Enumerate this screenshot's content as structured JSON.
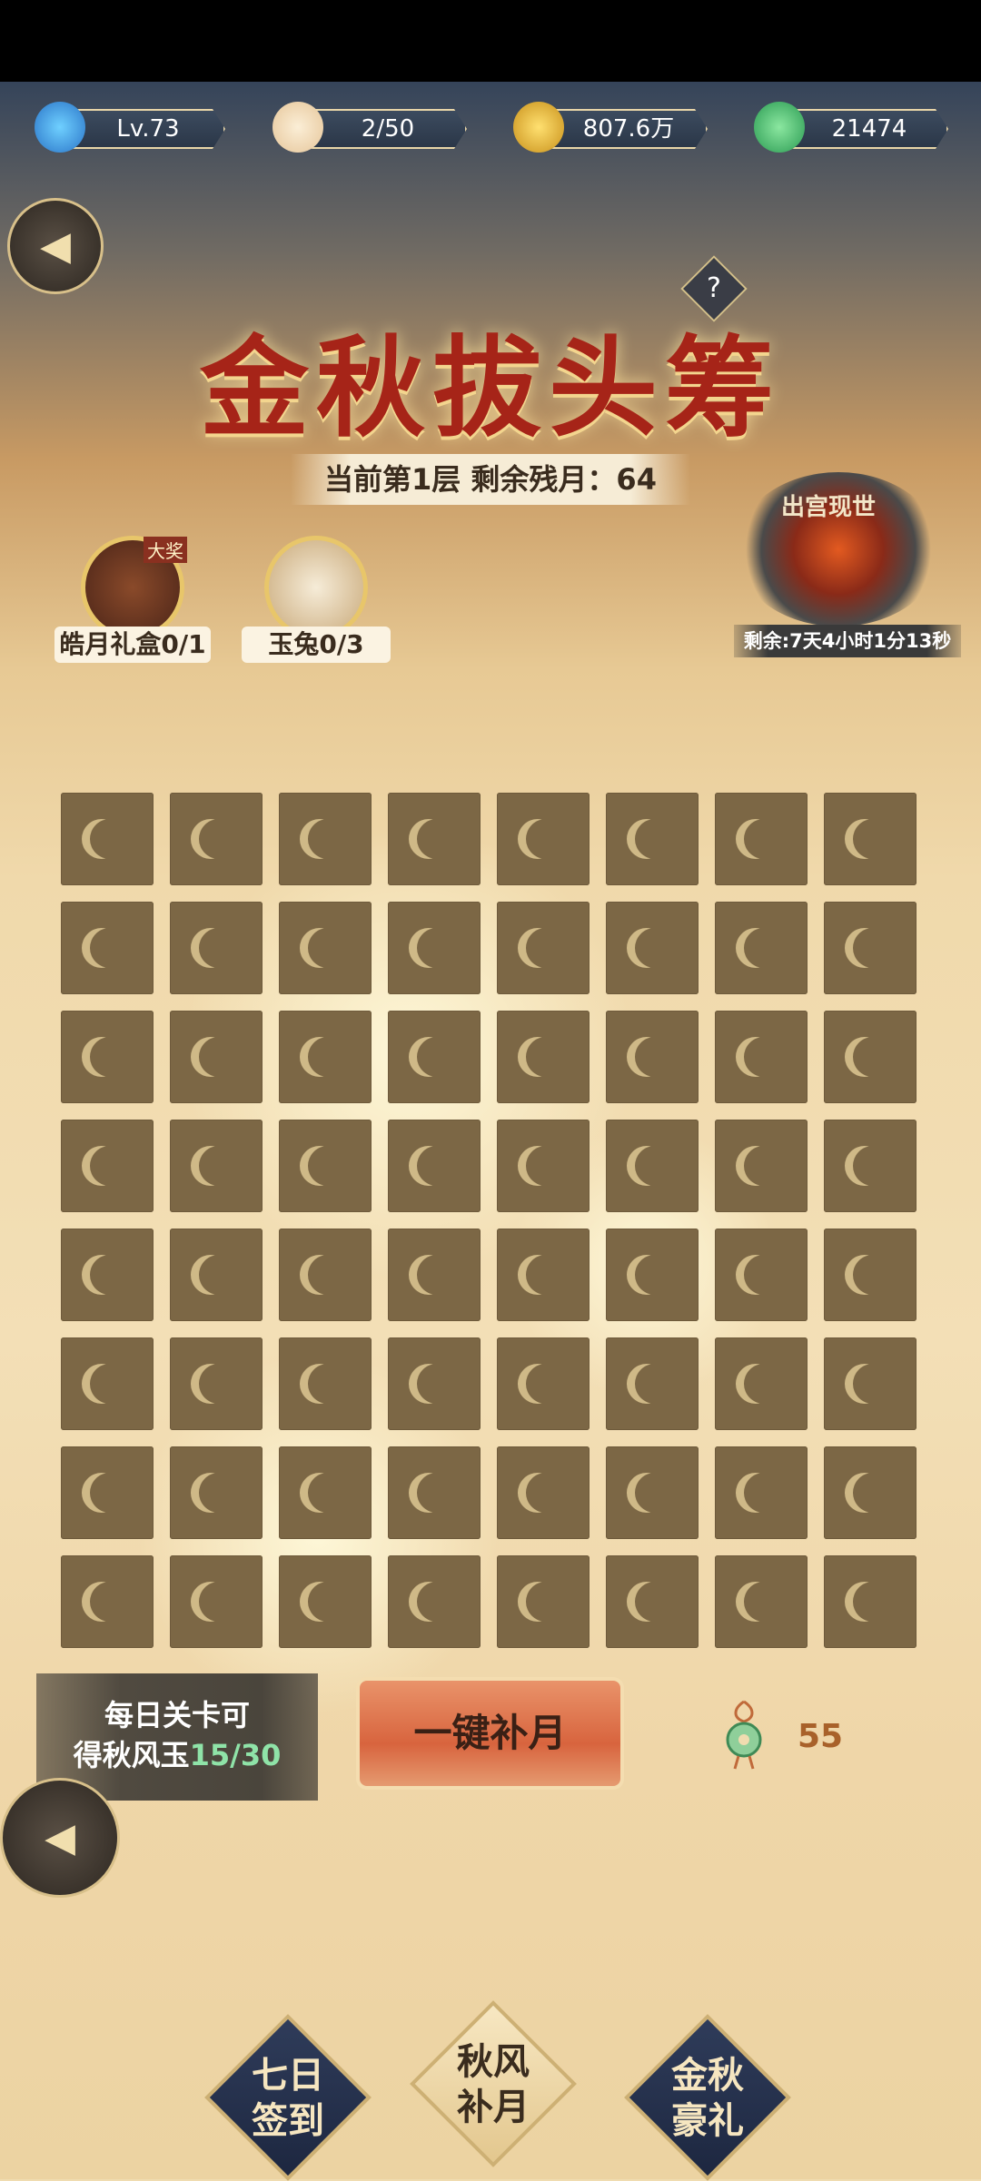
{
  "resources": [
    {
      "name": "level",
      "icon": "dragon-level-icon",
      "value": "Lv.73"
    },
    {
      "name": "stamina",
      "icon": "bun-icon",
      "value": "2/50"
    },
    {
      "name": "coins",
      "icon": "gold-coin-icon",
      "value": "807.6万"
    },
    {
      "name": "jade",
      "icon": "jade-leaf-icon",
      "value": "21474"
    }
  ],
  "header": {
    "title": "金秋拔头筹",
    "floor_text": "当前第1层 剩余残月：64",
    "help": "?"
  },
  "rewards": [
    {
      "label": "皓月礼盒0/1",
      "tag": "大奖",
      "icon": "gift-box-icon"
    },
    {
      "label": "玉兔0/3",
      "icon": "jade-rabbit-icon"
    }
  ],
  "boss": {
    "title": "出宫现世",
    "timer": "剩余:7天4小时1分13秒"
  },
  "grid": {
    "rows": 8,
    "cols": 8,
    "cell_icon": "crescent-moon-icon"
  },
  "daily": {
    "line1": "每日关卡可",
    "line2_prefix": "得秋风玉",
    "progress": "15/30"
  },
  "one_key_button": "一键补月",
  "jade_pendant": {
    "count": "55"
  },
  "nav": [
    {
      "line1": "七日",
      "line2": "签到"
    },
    {
      "line1": "秋风",
      "line2": "补月"
    },
    {
      "line1": "金秋",
      "line2": "豪礼"
    }
  ],
  "colors": {
    "accent_red": "#a62418",
    "tile": "#7c6745",
    "highlight_green": "#8fe3a8"
  }
}
